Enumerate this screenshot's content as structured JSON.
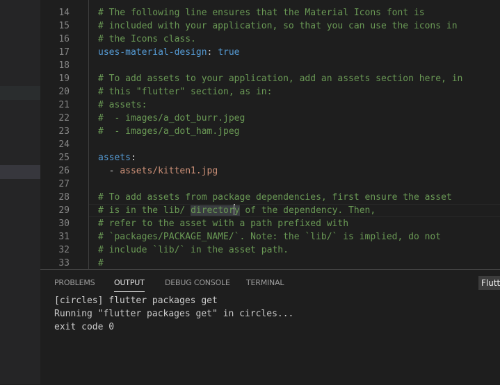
{
  "editor": {
    "lines": [
      {
        "n": "14",
        "parts": [
          {
            "t": "# The following line ensures that the Material Icons font is",
            "c": "c"
          }
        ]
      },
      {
        "n": "15",
        "parts": [
          {
            "t": "# included with your application, so that you can use the icons in",
            "c": "c"
          }
        ]
      },
      {
        "n": "16",
        "parts": [
          {
            "t": "# the Icons class.",
            "c": "c"
          }
        ]
      },
      {
        "n": "17",
        "parts": [
          {
            "t": "uses-material-design",
            "c": "k"
          },
          {
            "t": ": ",
            "c": "p"
          },
          {
            "t": "true",
            "c": "v"
          }
        ]
      },
      {
        "n": "18",
        "parts": []
      },
      {
        "n": "19",
        "parts": [
          {
            "t": "# To add assets to your application, add an assets section here, in",
            "c": "c"
          }
        ]
      },
      {
        "n": "20",
        "parts": [
          {
            "t": "# this \"flutter\" section, as in:",
            "c": "c"
          }
        ]
      },
      {
        "n": "21",
        "parts": [
          {
            "t": "# assets:",
            "c": "c"
          }
        ]
      },
      {
        "n": "22",
        "parts": [
          {
            "t": "#  - images/a_dot_burr.jpeg",
            "c": "c"
          }
        ]
      },
      {
        "n": "23",
        "parts": [
          {
            "t": "#  - images/a_dot_ham.jpeg",
            "c": "c"
          }
        ]
      },
      {
        "n": "24",
        "parts": []
      },
      {
        "n": "25",
        "parts": [
          {
            "t": "assets",
            "c": "k"
          },
          {
            "t": ":",
            "c": "p"
          }
        ]
      },
      {
        "n": "26",
        "parts": [
          {
            "t": "  - ",
            "c": "p"
          },
          {
            "t": "assets/kitten1.jpg",
            "c": "s"
          }
        ]
      },
      {
        "n": "27",
        "parts": []
      },
      {
        "n": "28",
        "parts": [
          {
            "t": "# To add assets from package dependencies, first ensure the asset",
            "c": "c"
          }
        ]
      },
      {
        "n": "29",
        "current": true,
        "parts": [
          {
            "t": "# is in the lib/ ",
            "c": "c"
          },
          {
            "t": "director",
            "c": "c hl"
          },
          {
            "t": "CURSOR",
            "c": "cursor"
          },
          {
            "t": "y",
            "c": "c hl"
          },
          {
            "t": " of the dependency. Then,",
            "c": "c"
          }
        ]
      },
      {
        "n": "30",
        "parts": [
          {
            "t": "# refer to the asset with a path prefixed with",
            "c": "c"
          }
        ]
      },
      {
        "n": "31",
        "parts": [
          {
            "t": "# `packages/PACKAGE_NAME/`. Note: the `lib/` is implied, do not",
            "c": "c"
          }
        ]
      },
      {
        "n": "32",
        "parts": [
          {
            "t": "# include `lib/` in the asset path.",
            "c": "c"
          }
        ]
      },
      {
        "n": "33",
        "parts": [
          {
            "t": "#",
            "c": "c"
          }
        ]
      }
    ]
  },
  "panel": {
    "tabs": [
      {
        "label": "PROBLEMS",
        "active": false
      },
      {
        "label": "OUTPUT",
        "active": true
      },
      {
        "label": "DEBUG CONSOLE",
        "active": false
      },
      {
        "label": "TERMINAL",
        "active": false
      }
    ],
    "output_channel": "Flutt",
    "output_lines": [
      "[circles] flutter packages get",
      "Running \"flutter packages get\" in circles...",
      "exit code 0"
    ]
  }
}
